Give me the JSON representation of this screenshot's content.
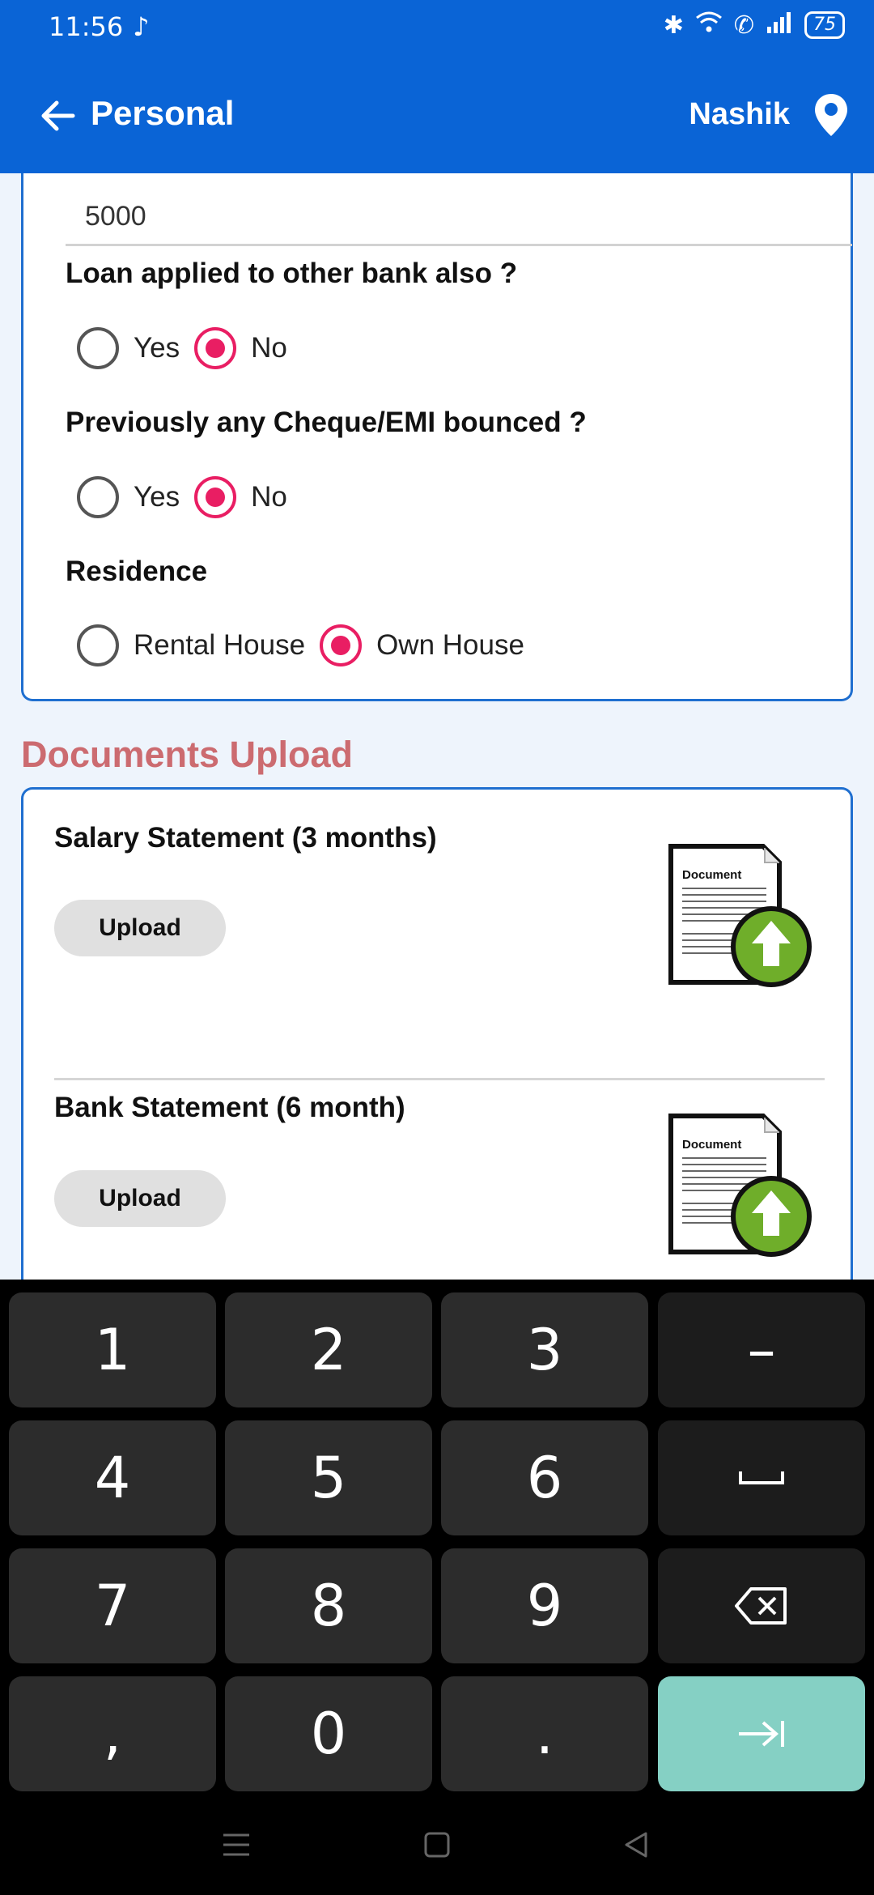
{
  "status_bar": {
    "time": "11:56",
    "battery": "75"
  },
  "app_bar": {
    "title": "Personal",
    "location": "Nashik"
  },
  "form": {
    "amount_value": "5000",
    "q_other_bank": {
      "label": "Loan applied to other bank also ?",
      "options": [
        "Yes",
        "No"
      ],
      "selected": "No"
    },
    "q_bounced": {
      "label": "Previously any Cheque/EMI bounced ?",
      "options": [
        "Yes",
        "No"
      ],
      "selected": "No"
    },
    "q_residence": {
      "label": "Residence",
      "options": [
        "Rental House",
        "Own House"
      ],
      "selected": "Own House"
    }
  },
  "documents": {
    "section_title": "Documents Upload",
    "items": [
      {
        "title": "Salary Statement (3 months)",
        "button": "Upload",
        "icon_label": "Document"
      },
      {
        "title": "Bank Statement (6 month)",
        "button": "Upload",
        "icon_label": "Document"
      }
    ]
  },
  "keyboard": {
    "keys": [
      "1",
      "2",
      "3",
      "–",
      "4",
      "5",
      "6",
      "␣",
      "7",
      "8",
      "9",
      "backspace",
      ",",
      "0",
      ".",
      "enter"
    ]
  }
}
